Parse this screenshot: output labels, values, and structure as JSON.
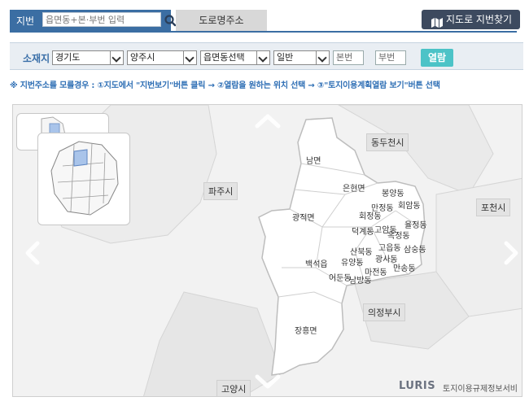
{
  "top": {
    "jibun_tab": "지번",
    "search_placeholder": "읍면동+본·부번 입력",
    "road_tab": "도로명주소",
    "map_search_button": "지도로 지번찾기"
  },
  "filter": {
    "location_label": "소재지",
    "sido": "경기도",
    "sigungu": "양주시",
    "eupmyeondong": "읍면동선택",
    "land_type": "일반",
    "main_no_placeholder": "본번",
    "dash": "-",
    "sub_no_placeholder": "부번",
    "view_button": "열람"
  },
  "help_text": "※ 지번주소를 모를경우 : ①지도에서 \"지번보기\"버튼 클릭 → ②열람을 원하는 위치 선택 → ③\"토지이용계획열람 보기\"버튼 선택",
  "map": {
    "regions": {
      "dongducheon": "동두천시",
      "paju": "파주시",
      "pocheon": "포천시",
      "uijeongbu": "의정부시",
      "goyang": "고양시"
    },
    "dongs": {
      "nam": "남면",
      "eunhyeon": "은현면",
      "gwangjeok": "광적면",
      "bongyang": "봉양동",
      "hoeam": "회암동",
      "manjeong": "만정동",
      "hoejeong": "회정동",
      "yulieong": "율정동",
      "deokgye": "덕계동",
      "goam": "고암동",
      "okjeong": "옥정동",
      "sanbuk": "산북동",
      "goeup": "고읍동",
      "samsung": "삼숭동",
      "baekseok": "백석읍",
      "yuyang": "유양동",
      "gwangsa": "광사동",
      "majeon": "마전동",
      "mansong": "만송동",
      "eodun": "어둔동",
      "nambang": "남방동",
      "jangheung": "장흥면"
    },
    "brand": "LURIS",
    "brand_sub": "토지이용규제정보서비스"
  },
  "colors": {
    "primary_blue": "#3b6ea3",
    "dark_button": "#3d4a5f",
    "teal_button": "#4cc3c7",
    "help_text": "#2f6fb5"
  }
}
